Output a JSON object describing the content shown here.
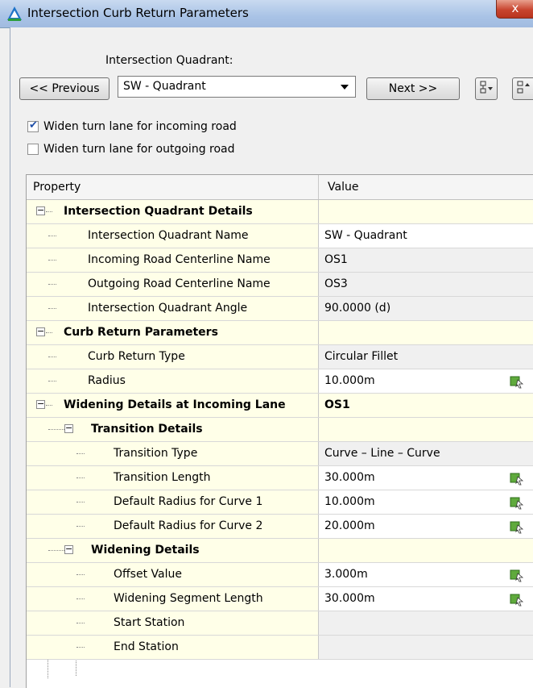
{
  "window": {
    "title": "Intersection Curb Return Parameters",
    "close_label": "x"
  },
  "quadrant": {
    "label": "Intersection Quadrant:",
    "previous_label": "<< Previous",
    "selected": "SW - Quadrant",
    "next_label": "Next >>"
  },
  "options": {
    "widen_incoming": {
      "label": "Widen turn lane for incoming road",
      "checked": true
    },
    "widen_outgoing": {
      "label": "Widen turn lane for outgoing road",
      "checked": false
    }
  },
  "grid": {
    "headers": {
      "property": "Property",
      "value": "Value"
    },
    "rows": [
      {
        "label": "Intersection Quadrant Details",
        "value": "",
        "category": true
      },
      {
        "label": "Intersection Quadrant Name",
        "value": "SW - Quadrant"
      },
      {
        "label": "Incoming Road Centerline Name",
        "value": "OS1"
      },
      {
        "label": "Outgoing Road Centerline Name",
        "value": "OS3"
      },
      {
        "label": "Intersection Quadrant Angle",
        "value": "90.0000 (d)"
      },
      {
        "label": "Curb Return Parameters",
        "value": "",
        "category": true
      },
      {
        "label": "Curb Return Type",
        "value": "Circular Fillet"
      },
      {
        "label": "Radius",
        "value": "10.000m"
      },
      {
        "label": "Widening Details at Incoming Lane",
        "value": "OS1",
        "category": true
      },
      {
        "label": "Transition Details",
        "value": "",
        "category": true
      },
      {
        "label": "Transition Type",
        "value": "Curve – Line – Curve"
      },
      {
        "label": "Transition Length",
        "value": "30.000m"
      },
      {
        "label": "Default Radius for Curve 1",
        "value": "10.000m"
      },
      {
        "label": "Default Radius for Curve 2",
        "value": "20.000m"
      },
      {
        "label": "Widening Details",
        "value": "",
        "category": true
      },
      {
        "label": "Offset Value",
        "value": "3.000m"
      },
      {
        "label": "Widening Segment Length",
        "value": "30.000m"
      },
      {
        "label": "Start Station",
        "value": ""
      },
      {
        "label": "End Station",
        "value": ""
      }
    ]
  }
}
